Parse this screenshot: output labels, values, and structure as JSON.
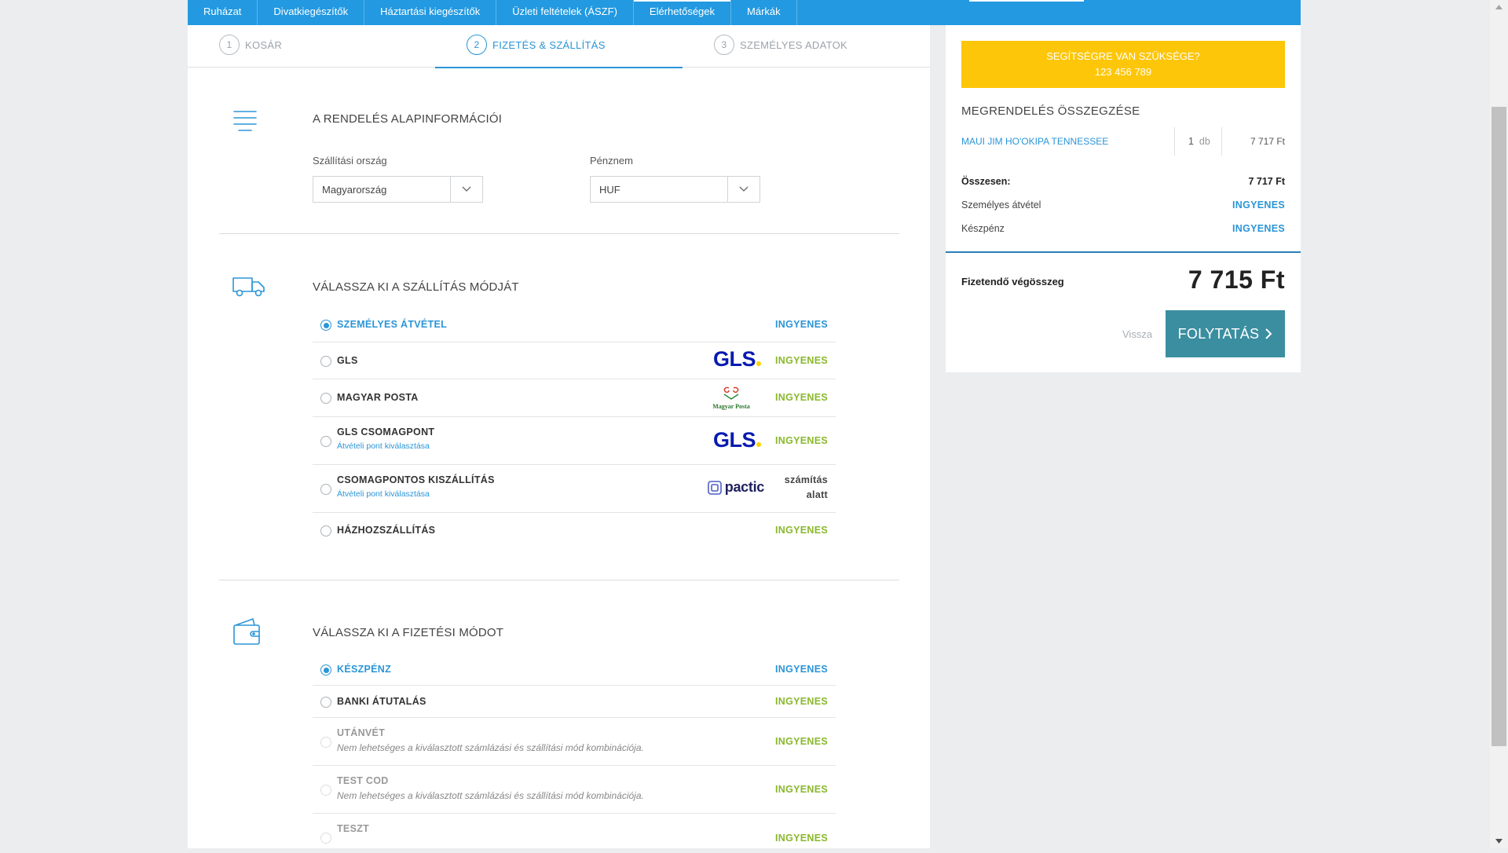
{
  "topnav": {
    "items": [
      "Ruházat",
      "Divatkiegészítők",
      "Háztartási kiegészítők",
      "Üzleti feltételek (ÁSZF)",
      "Elérhetőségek",
      "Márkák"
    ]
  },
  "steps": [
    {
      "num": "1",
      "label": "KOSÁR"
    },
    {
      "num": "2",
      "label": "FIZETÉS & SZÁLLÍTÁS"
    },
    {
      "num": "3",
      "label": "SZEMÉLYES ADATOK"
    }
  ],
  "basic_info": {
    "title": "A RENDELÉS ALAPINFORMÁCIÓI",
    "country_label": "Szállítási ország",
    "country_value": "Magyarország",
    "currency_label": "Pénznem",
    "currency_value": "HUF"
  },
  "shipping": {
    "title": "VÁLASSZA KI A SZÁLLÍTÁS MÓDJÁT",
    "options": [
      {
        "label": "SZEMÉLYES ÁTVÉTEL",
        "price": "INGYENES",
        "selected": true
      },
      {
        "label": "GLS",
        "price": "INGYENES",
        "logo": "gls-logo"
      },
      {
        "label": "MAGYAR POSTA",
        "price": "INGYENES",
        "logo": "magyar-posta-logo"
      },
      {
        "label": "GLS CSOMAGPONT",
        "sub": "Átvételi pont kiválasztása",
        "price": "INGYENES",
        "logo": "gls-logo"
      },
      {
        "label": "CSOMAGPONTOS KISZÁLLÍTÁS",
        "sub": "Átvételi pont kiválasztása",
        "price": "számítás alatt",
        "logo": "pactic-logo"
      },
      {
        "label": "HÁZHOZSZÁLLÍTÁS",
        "price": "INGYENES"
      }
    ]
  },
  "logos": {
    "gls": "GLS",
    "pactic": "pactic",
    "posta": "Magyar Posta"
  },
  "payment": {
    "title": "VÁLASSZA KI A FIZETÉSI MÓDOT",
    "options": [
      {
        "label": "KÉSZPÉNZ",
        "price": "INGYENES",
        "selected": true
      },
      {
        "label": "BANKI ÁTUTALÁS",
        "price": "INGYENES"
      },
      {
        "label": "UTÁNVÉT",
        "sub": "Nem lehetséges a kiválasztott számlázási és szállítási mód kombinációja.",
        "price": "INGYENES",
        "disabled": true
      },
      {
        "label": "TEST COD",
        "sub": "Nem lehetséges a kiválasztott számlázási és szállítási mód kombinációja.",
        "price": "INGYENES",
        "disabled": true
      },
      {
        "label": "TESZT",
        "price": "INGYENES",
        "disabled": true
      }
    ]
  },
  "summary": {
    "help_line1": "SEGÍTSÉGRE VAN SZÜKSÉGE?",
    "help_line2": "123 456 789",
    "title": "MEGRENDELÉS ÖSSZEGZÉSE",
    "item_name": "MAUI JIM HO'OKIPA TENNESSEE",
    "item_qty": "1",
    "item_qty_unit": "db",
    "item_price": "7 717 Ft",
    "subtotal_label": "Összesen:",
    "subtotal_value": "7 717 Ft",
    "shipping_label": "Személyes átvétel",
    "shipping_value": "INGYENES",
    "payment_label": "Készpénz",
    "payment_value": "INGYENES",
    "total_label": "Fizetendő végösszeg",
    "total_value": "7 715 Ft",
    "back_label": "Vissza",
    "continue_label": "FOLYTATÁS"
  },
  "colors": {
    "accent": "#2b95d7",
    "nav": "#2299e0",
    "help": "#fdc609",
    "free": "#8ab82d",
    "button": "#3b8ea0"
  }
}
